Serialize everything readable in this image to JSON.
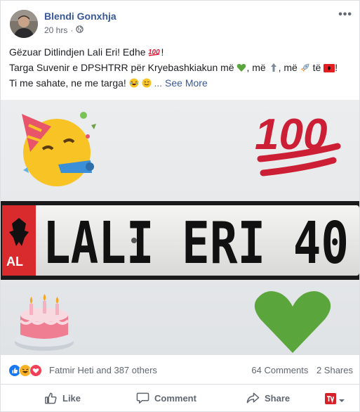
{
  "post": {
    "author": "Blendi Gonxhja",
    "time": "20 hrs",
    "dot": "·",
    "more": "•••",
    "line1": "Gëzuar Ditlindjen Lali Eri! Edhe",
    "line1_end": "!",
    "line2_a": "Targa Suvenir e DPSHTRR për Kryebashkiakun më",
    "line2_b": ", më",
    "line2_c": ", më",
    "line2_d": "të",
    "line2_end": "!",
    "line3": "Ti me sahate, ne me targa!",
    "ellipsis": "...",
    "see_more": "See More"
  },
  "plate": {
    "country": "AL",
    "text": "LALI ERI 40"
  },
  "stats": {
    "reactors": "Fatmir Heti and 387 others",
    "comments": "64 Comments",
    "shares": "2 Shares"
  },
  "actions": {
    "like": "Like",
    "comment": "Comment",
    "share": "Share"
  },
  "colors": {
    "link": "#385898",
    "like_blue": "#1877f2",
    "love_red": "#f33e58",
    "haha_yellow": "#f7b125",
    "heart_green": "#5aa53c"
  }
}
